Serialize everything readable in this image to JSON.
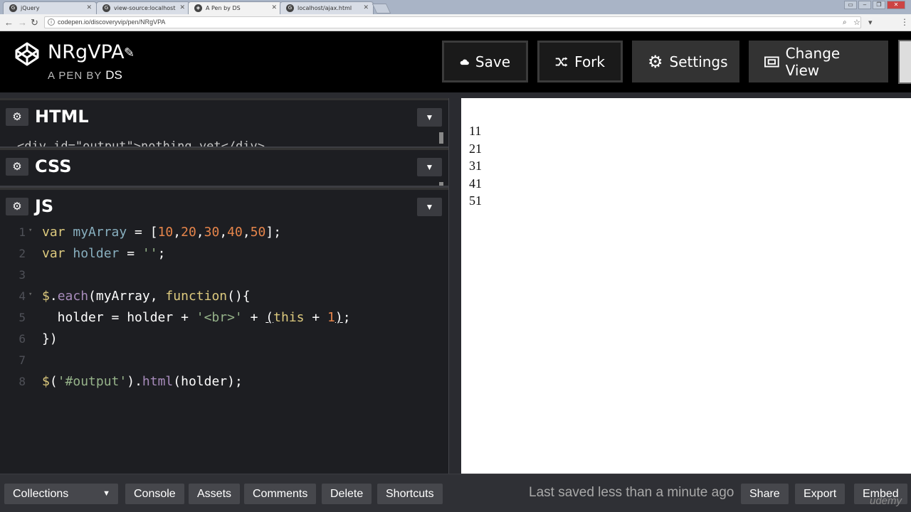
{
  "browser": {
    "tabs": [
      {
        "label": "jQuery",
        "active": false
      },
      {
        "label": "view-source:localhost",
        "active": false
      },
      {
        "label": "A Pen by DS",
        "active": true
      },
      {
        "label": "localhost/ajax.html",
        "active": false
      }
    ],
    "url": "codepen.io/discoveryvip/pen/NRgVPA"
  },
  "header": {
    "pen_title": "NRgVPA",
    "byline_prefix": "A PEN BY",
    "author": "DS",
    "buttons": {
      "save": "Save",
      "fork": "Fork",
      "settings": "Settings",
      "change_view": "Change View"
    }
  },
  "editors": {
    "html": {
      "title": "HTML",
      "peek": "<div id=\"output\">nothing yet</div>"
    },
    "css": {
      "title": "CSS"
    },
    "js": {
      "title": "JS",
      "line_numbers": [
        "1",
        "2",
        "3",
        "4",
        "5",
        "6",
        "7",
        "8"
      ]
    }
  },
  "preview": {
    "output_lines": [
      "11",
      "21",
      "31",
      "41",
      "51"
    ]
  },
  "footer": {
    "collections": "Collections",
    "console": "Console",
    "assets": "Assets",
    "comments": "Comments",
    "delete": "Delete",
    "shortcuts": "Shortcuts",
    "saved_status": "Last saved less than a minute ago",
    "share": "Share",
    "export": "Export",
    "embed": "Embed"
  },
  "watermark": "udemy"
}
